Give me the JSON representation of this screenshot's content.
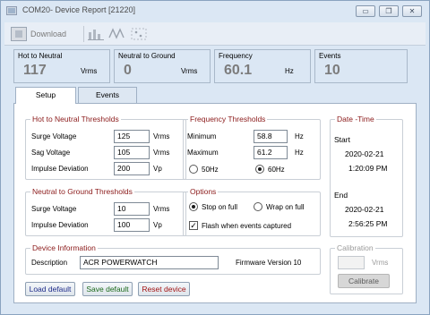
{
  "window": {
    "title": "COM20- Device Report [21220]",
    "buttons": {
      "minimize": "▭",
      "restore": "❐",
      "close": "✕"
    }
  },
  "toolbar": {
    "download_label": "Download"
  },
  "readouts": [
    {
      "label": "Hot to Neutral",
      "value": "117",
      "unit": "Vrms"
    },
    {
      "label": "Neutral to Ground",
      "value": "0",
      "unit": "Vrms"
    },
    {
      "label": "Frequency",
      "value": "60.1",
      "unit": "Hz"
    },
    {
      "label": "Events",
      "value": "10",
      "unit": ""
    }
  ],
  "tabs": [
    {
      "label": "Setup",
      "active": true
    },
    {
      "label": "Events",
      "active": false
    }
  ],
  "hot_to_neutral": {
    "title": "Hot to Neutral Thresholds",
    "surge_label": "Surge Voltage",
    "surge_value": "125",
    "surge_unit": "Vrms",
    "sag_label": "Sag Voltage",
    "sag_value": "105",
    "sag_unit": "Vrms",
    "impulse_label": "Impulse Deviation",
    "impulse_value": "200",
    "impulse_unit": "Vp"
  },
  "frequency": {
    "title": "Frequency Thresholds",
    "min_label": "Minimum",
    "min_value": "58.8",
    "min_unit": "Hz",
    "max_label": "Maximum",
    "max_value": "61.2",
    "max_unit": "Hz",
    "option_50": "50Hz",
    "option_60": "60Hz",
    "selected": "60Hz"
  },
  "datetime": {
    "title": "Date -Time",
    "start_label": "Start",
    "start_date": "2020-02-21",
    "start_time": "1:20:09 PM",
    "end_label": "End",
    "end_date": "2020-02-21",
    "end_time": "2:56:25 PM"
  },
  "neutral_to_ground": {
    "title": "Neutral to Ground Thresholds",
    "surge_label": "Surge Voltage",
    "surge_value": "10",
    "surge_unit": "Vrms",
    "impulse_label": "Impulse Deviation",
    "impulse_value": "100",
    "impulse_unit": "Vp"
  },
  "options": {
    "title": "Options",
    "stop_on_full": "Stop on full",
    "wrap_on_full": "Wrap on full",
    "selected": "Stop on full",
    "flash_label": "Flash when events captured",
    "flash_checked": true
  },
  "device": {
    "title": "Device Information",
    "description_label": "Description",
    "description_value": "ACR POWERWATCH",
    "firmware": "Firmware Version 10"
  },
  "calibration": {
    "title": "Calibration",
    "unit": "Vrms",
    "button": "Calibrate",
    "value": ""
  },
  "actions": {
    "load_default": "Load default",
    "save_default": "Save default",
    "reset_device": "Reset device"
  },
  "colors": {
    "group_title": "#8b1a1a",
    "load": "#1f2d8a",
    "save": "#1c6b1c",
    "reset": "#a31515"
  }
}
